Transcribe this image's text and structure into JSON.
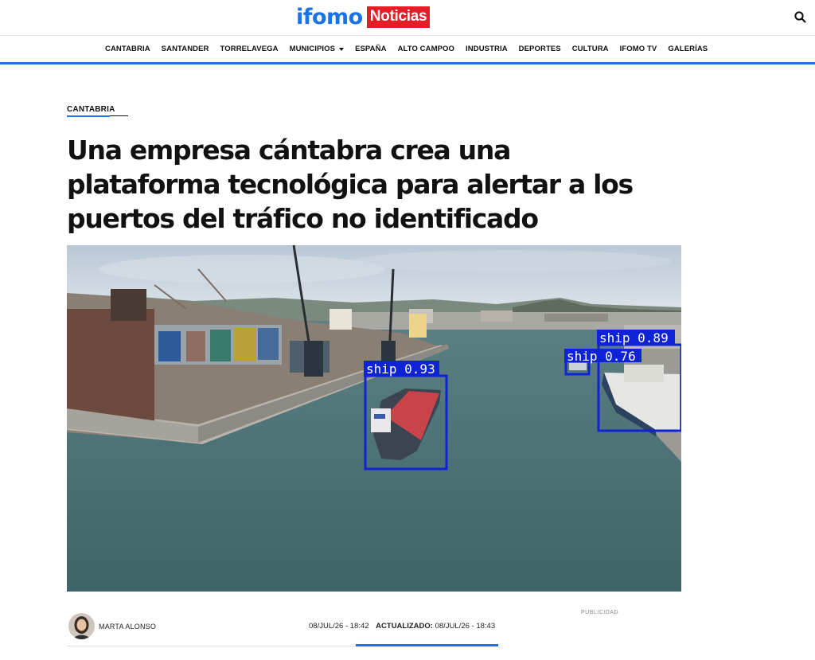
{
  "header": {
    "logo_main": "ifomo",
    "logo_tag": "Noticias",
    "search_icon": "search-icon",
    "accent_color": "#1a73e8",
    "tag_color": "#e41e26"
  },
  "nav": {
    "items": [
      {
        "label": "CANTABRIA"
      },
      {
        "label": "SANTANDER"
      },
      {
        "label": "TORRELAVEGA"
      },
      {
        "label": "MUNICIPIOS"
      },
      {
        "label": "ESPAÑA"
      },
      {
        "label": "ALTO CAMPOO"
      },
      {
        "label": "INDUSTRIA"
      },
      {
        "label": "DEPORTES"
      },
      {
        "label": "CULTURA"
      },
      {
        "label": "IFOMO TV"
      },
      {
        "label": "GALERÍAS"
      }
    ]
  },
  "article": {
    "section": "CANTABRIA",
    "headline": "Una empresa cántabra crea una plataforma tecnológica para alertar a los puertos del tráfico no identificado",
    "image": {
      "detections": [
        {
          "label": "ship 0.93"
        },
        {
          "label": "ship 0.76"
        },
        {
          "label": "ship 0.89"
        }
      ]
    },
    "advert_label": "PUBLICIDAD",
    "author": "MARTA ALONSO",
    "published": "08/JUL/26 - 18:42",
    "updated_label": "ACTUALIZADO:",
    "updated": "08/JUL/26 - 18:43"
  }
}
